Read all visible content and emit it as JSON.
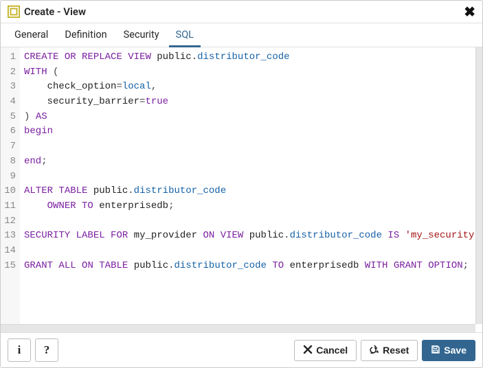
{
  "header": {
    "title": "Create - View"
  },
  "tabs": [
    {
      "id": "general",
      "label": "General",
      "active": false
    },
    {
      "id": "definition",
      "label": "Definition",
      "active": false
    },
    {
      "id": "security",
      "label": "Security",
      "active": false
    },
    {
      "id": "sql",
      "label": "SQL",
      "active": true
    }
  ],
  "sql_tokens": [
    [
      [
        "kw",
        "CREATE"
      ],
      [
        "sp",
        " "
      ],
      [
        "kw",
        "OR"
      ],
      [
        "sp",
        " "
      ],
      [
        "kw",
        "REPLACE"
      ],
      [
        "sp",
        " "
      ],
      [
        "kw",
        "VIEW"
      ],
      [
        "sp",
        " "
      ],
      [
        "t",
        "public"
      ],
      [
        "op",
        "."
      ],
      [
        "id",
        "distributor_code"
      ]
    ],
    [
      [
        "kw",
        "WITH"
      ],
      [
        "sp",
        " "
      ],
      [
        "op",
        "("
      ]
    ],
    [
      [
        "sp",
        "    "
      ],
      [
        "t",
        "check_option"
      ],
      [
        "op",
        "="
      ],
      [
        "id",
        "local"
      ],
      [
        "op",
        ","
      ]
    ],
    [
      [
        "sp",
        "    "
      ],
      [
        "t",
        "security_barrier"
      ],
      [
        "op",
        "="
      ],
      [
        "bool",
        "true"
      ]
    ],
    [
      [
        "op",
        ")"
      ],
      [
        "sp",
        " "
      ],
      [
        "kw",
        "AS"
      ]
    ],
    [
      [
        "kw",
        "begin"
      ]
    ],
    [],
    [
      [
        "kw",
        "end"
      ],
      [
        "op",
        ";"
      ]
    ],
    [],
    [
      [
        "kw",
        "ALTER"
      ],
      [
        "sp",
        " "
      ],
      [
        "kw",
        "TABLE"
      ],
      [
        "sp",
        " "
      ],
      [
        "t",
        "public"
      ],
      [
        "op",
        "."
      ],
      [
        "id",
        "distributor_code"
      ]
    ],
    [
      [
        "sp",
        "    "
      ],
      [
        "kw",
        "OWNER"
      ],
      [
        "sp",
        " "
      ],
      [
        "kw",
        "TO"
      ],
      [
        "sp",
        " "
      ],
      [
        "t",
        "enterprisedb"
      ],
      [
        "op",
        ";"
      ]
    ],
    [],
    [
      [
        "kw",
        "SECURITY"
      ],
      [
        "sp",
        " "
      ],
      [
        "kw",
        "LABEL"
      ],
      [
        "sp",
        " "
      ],
      [
        "kw",
        "FOR"
      ],
      [
        "sp",
        " "
      ],
      [
        "t",
        "my_provider"
      ],
      [
        "sp",
        " "
      ],
      [
        "kw",
        "ON"
      ],
      [
        "sp",
        " "
      ],
      [
        "kw",
        "VIEW"
      ],
      [
        "sp",
        " "
      ],
      [
        "t",
        "public"
      ],
      [
        "op",
        "."
      ],
      [
        "id",
        "distributor_code"
      ],
      [
        "sp",
        " "
      ],
      [
        "kw",
        "IS"
      ],
      [
        "sp",
        " "
      ],
      [
        "str",
        "'my_security'"
      ],
      [
        "op",
        ";"
      ]
    ],
    [],
    [
      [
        "kw",
        "GRANT"
      ],
      [
        "sp",
        " "
      ],
      [
        "kw",
        "ALL"
      ],
      [
        "sp",
        " "
      ],
      [
        "kw",
        "ON"
      ],
      [
        "sp",
        " "
      ],
      [
        "kw",
        "TABLE"
      ],
      [
        "sp",
        " "
      ],
      [
        "t",
        "public"
      ],
      [
        "op",
        "."
      ],
      [
        "id",
        "distributor_code"
      ],
      [
        "sp",
        " "
      ],
      [
        "kw",
        "TO"
      ],
      [
        "sp",
        " "
      ],
      [
        "t",
        "enterprisedb"
      ],
      [
        "sp",
        " "
      ],
      [
        "kw",
        "WITH"
      ],
      [
        "sp",
        " "
      ],
      [
        "kw",
        "GRANT"
      ],
      [
        "sp",
        " "
      ],
      [
        "kw",
        "OPTION"
      ],
      [
        "op",
        ";"
      ]
    ]
  ],
  "footer": {
    "info": "i",
    "help": "?",
    "cancel": "Cancel",
    "reset": "Reset",
    "save": "Save"
  }
}
